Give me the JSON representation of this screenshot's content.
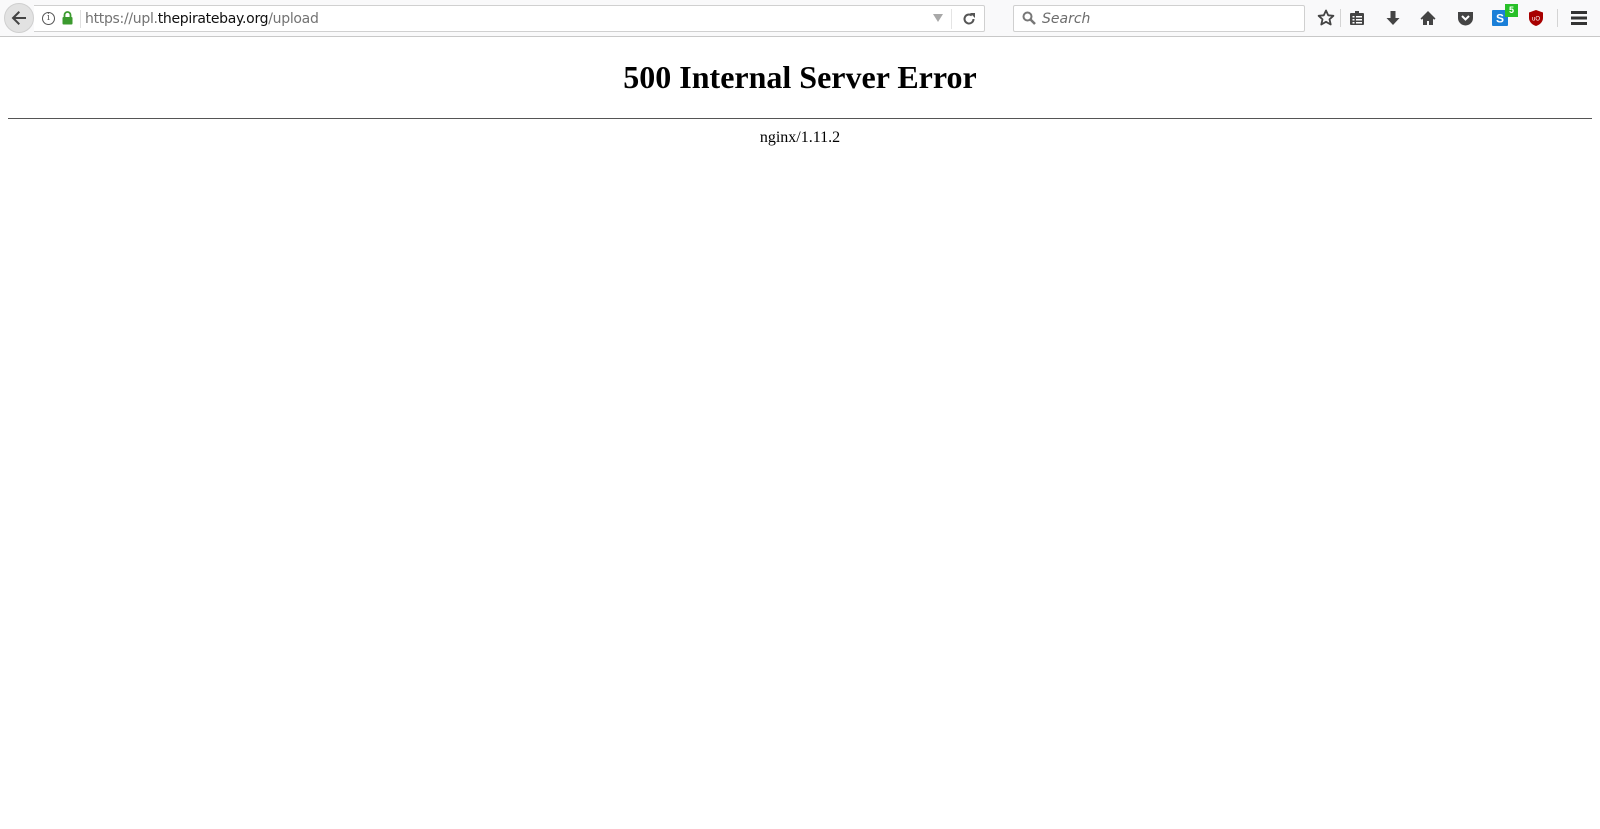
{
  "browser": {
    "url": {
      "scheme_prefix": "https://upl.",
      "host": "thepiratebay.org",
      "path": "/upload"
    },
    "search": {
      "placeholder": "Search",
      "value": ""
    },
    "toolbar_icons": [
      "back-icon",
      "info-icon",
      "lock-icon",
      "dropdown-icon",
      "reload-icon",
      "search-icon",
      "bookmark-star-icon",
      "reading-list-icon",
      "download-icon",
      "home-icon",
      "pocket-icon",
      "extension-s-icon",
      "ublock-icon",
      "menu-icon"
    ],
    "extension_badge": "5",
    "colors": {
      "lock": "#3b9a2e",
      "badge": "#28c028",
      "ublock": "#a80000",
      "extension": "#1a7fd8"
    }
  },
  "page": {
    "title": "500 Internal Server Error",
    "server": "nginx/1.11.2"
  }
}
